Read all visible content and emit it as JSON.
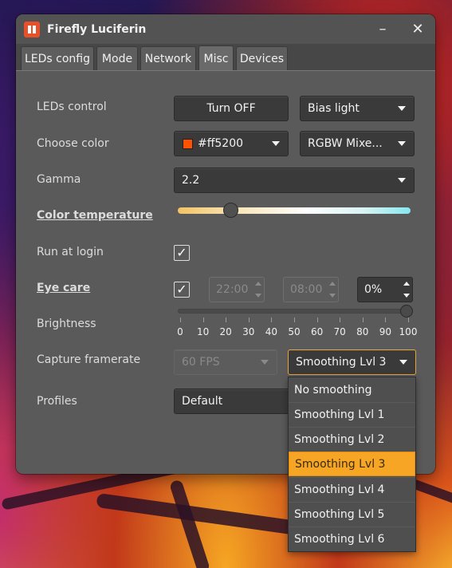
{
  "app": {
    "title": "Firefly Luciferin"
  },
  "window_controls": {
    "minimize": "–",
    "close": "✕"
  },
  "tabs": [
    {
      "label": "LEDs config",
      "active": false
    },
    {
      "label": "Mode",
      "active": false
    },
    {
      "label": "Network",
      "active": false
    },
    {
      "label": "Misc",
      "active": true
    },
    {
      "label": "Devices",
      "active": false
    }
  ],
  "leds_control": {
    "label": "LEDs control",
    "button": "Turn OFF",
    "mode_select": "Bias light"
  },
  "choose_color": {
    "label": "Choose color",
    "color_value": "#ff5200",
    "swatch_color": "#ff5200",
    "mode_select": "RGBW Mixe..."
  },
  "gamma": {
    "label": "Gamma",
    "value": "2.2"
  },
  "color_temperature": {
    "label": "Color temperature",
    "level": 0.23
  },
  "run_at_login": {
    "label": "Run at login",
    "checked": "✓"
  },
  "eye_care": {
    "label": "Eye care",
    "checked": "✓",
    "start_time": "22:00",
    "end_time": "08:00",
    "percent": "0%"
  },
  "brightness": {
    "label": "Brightness",
    "value": 100,
    "ticks": [
      "0",
      "10",
      "20",
      "30",
      "40",
      "50",
      "60",
      "70",
      "80",
      "90",
      "100"
    ]
  },
  "capture_framerate": {
    "label": "Capture framerate",
    "fps": "60 FPS",
    "smoothing": "Smoothing Lvl 3"
  },
  "profiles": {
    "label": "Profiles",
    "value": "Default"
  },
  "smoothing_options": [
    "No smoothing",
    "Smoothing Lvl 1",
    "Smoothing Lvl 2",
    "Smoothing Lvl 3",
    "Smoothing Lvl 4",
    "Smoothing Lvl 5",
    "Smoothing Lvl 6"
  ],
  "smoothing_selected_index": 3,
  "colors": {
    "accent": "#f6a524",
    "window_bg": "#5a5a5a",
    "control_bg": "#3a3a3a"
  }
}
